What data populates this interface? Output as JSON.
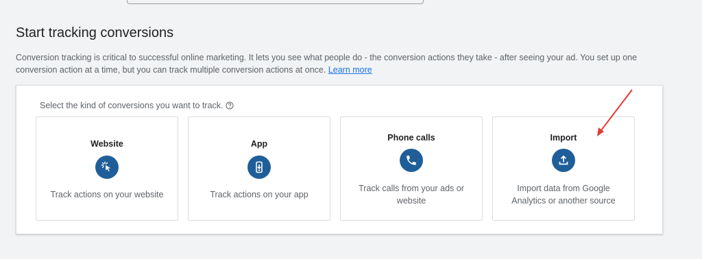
{
  "header": {
    "title": "Start tracking conversions",
    "description": "Conversion tracking is critical to successful online marketing. It lets you see what people do - the conversion actions they take - after seeing your ad. You set up one conversion action at a time, but you can track multiple conversion actions at once.",
    "learn_more": "Learn more"
  },
  "panel": {
    "prompt": "Select the kind of conversions you want to track.",
    "cards": [
      {
        "title": "Website",
        "icon": "cursor-click-icon",
        "description": "Track actions on your website"
      },
      {
        "title": "App",
        "icon": "mobile-download-icon",
        "description": "Track actions on your app"
      },
      {
        "title": "Phone calls",
        "icon": "phone-icon",
        "description": "Track calls from your ads or website"
      },
      {
        "title": "Import",
        "icon": "upload-icon",
        "description": "Import data from Google Analytics or another source"
      }
    ]
  },
  "colors": {
    "icon_bg": "#1f5e99",
    "link": "#1a73e8",
    "annotation_arrow": "#e53935"
  }
}
